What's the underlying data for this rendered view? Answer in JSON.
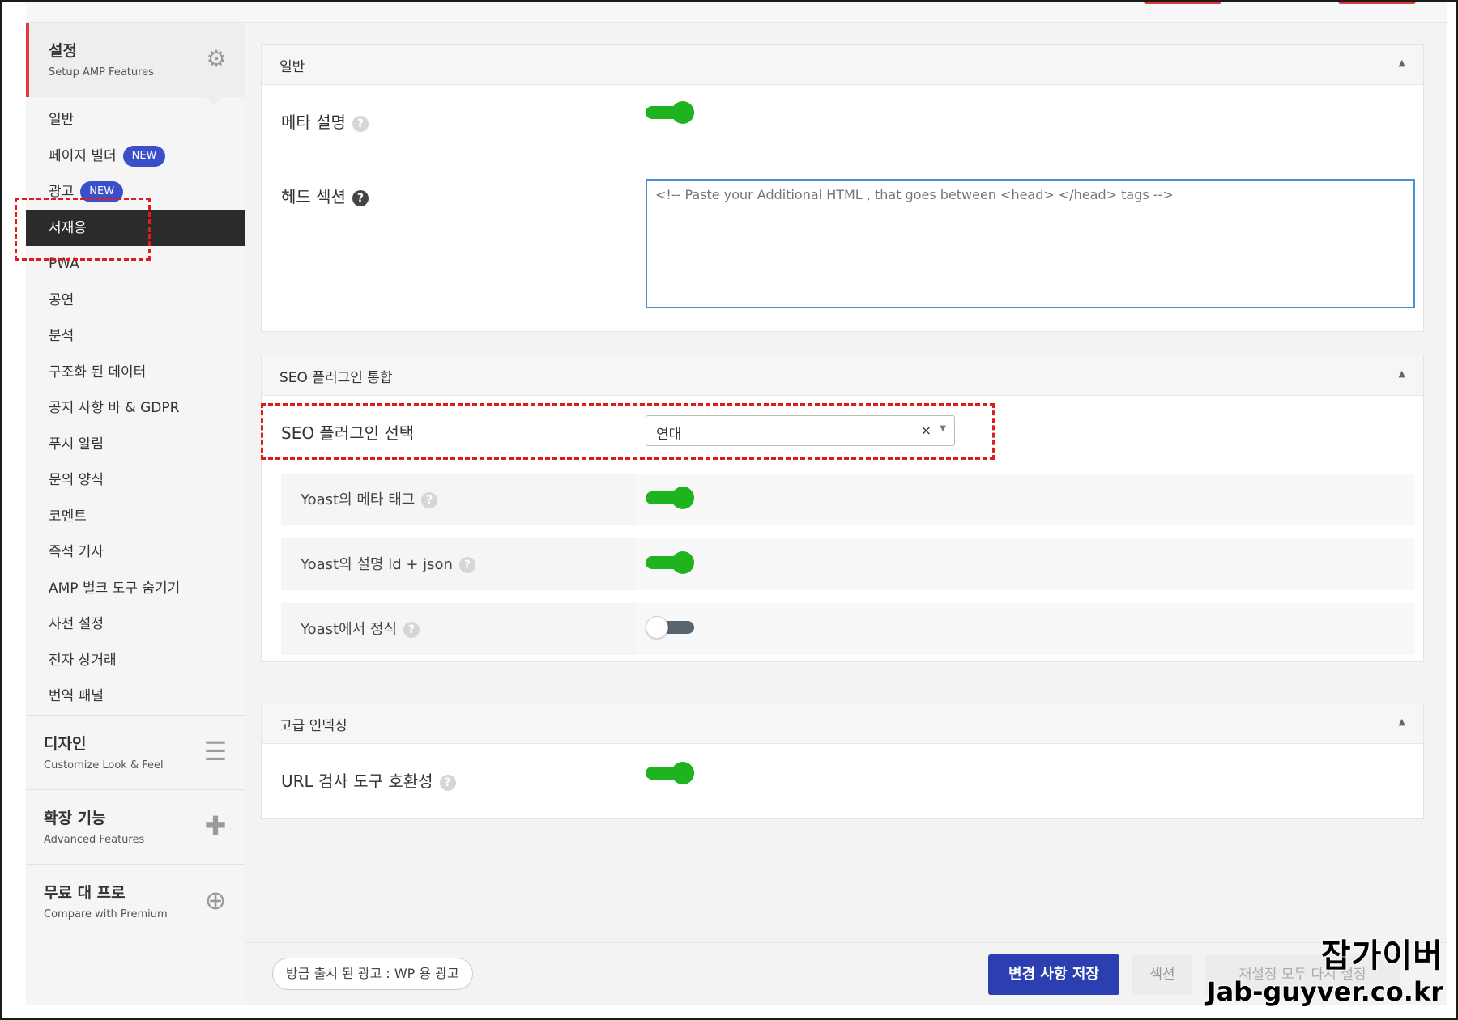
{
  "sidebar": {
    "header": {
      "title": "설정",
      "subtitle": "Setup AMP Features"
    },
    "items": [
      {
        "label": "일반"
      },
      {
        "label": "페이지 빌더",
        "badge": "NEW"
      },
      {
        "label": "광고",
        "badge": "NEW"
      },
      {
        "label": "서재응",
        "active": true
      },
      {
        "label": "PWA"
      },
      {
        "label": "공연"
      },
      {
        "label": "분석"
      },
      {
        "label": "구조화 된 데이터"
      },
      {
        "label": "공지 사항 바 & GDPR"
      },
      {
        "label": "푸시 알림"
      },
      {
        "label": "문의 양식"
      },
      {
        "label": "코멘트"
      },
      {
        "label": "즉석 기사"
      },
      {
        "label": "AMP 벌크 도구 숨기기"
      },
      {
        "label": "사전 설정"
      },
      {
        "label": "전자 상거래"
      },
      {
        "label": "번역 패널"
      }
    ],
    "sections": [
      {
        "title": "디자인",
        "subtitle": "Customize Look & Feel"
      },
      {
        "title": "확장 기능",
        "subtitle": "Advanced Features"
      },
      {
        "title": "무료 대 프로",
        "subtitle": "Compare with Premium"
      }
    ]
  },
  "panels": {
    "general": {
      "title": "일반",
      "meta_label": "메타 설명",
      "meta_on": true,
      "head_label": "헤드 섹션",
      "head_placeholder": "<!-- Paste your Additional HTML , that goes between <head> </head> tags -->"
    },
    "seo": {
      "title": "SEO 플러그인 통합",
      "select_label": "SEO 플러그인 선택",
      "select_value": "연대",
      "clear_symbol": "×",
      "options": [
        {
          "label": "Yoast의 메타 태그",
          "on": true
        },
        {
          "label": "Yoast의 설명 ld + json",
          "on": true
        },
        {
          "label": "Yoast에서 정식",
          "on": false
        }
      ]
    },
    "advanced": {
      "title": "고급 인덱싱",
      "url_label": "URL 검사 도구 호환성",
      "url_on": true
    }
  },
  "footer": {
    "news_pill": "방금 출시 된 광고 : WP 용 광고",
    "save_label": "변경 사항 저장",
    "section_label": "섹션",
    "reset_label": "재설정 모두 다시 설정"
  },
  "watermark": {
    "line1": "잡가이버",
    "line2": "Jab-guyver.co.kr"
  },
  "colors": {
    "accent_red": "#e0383e",
    "toggle_green": "#1fb31f",
    "primary_blue": "#2b3fb0",
    "badge_blue": "#3b4fc8",
    "highlight_dashed": "#e01b1b"
  }
}
